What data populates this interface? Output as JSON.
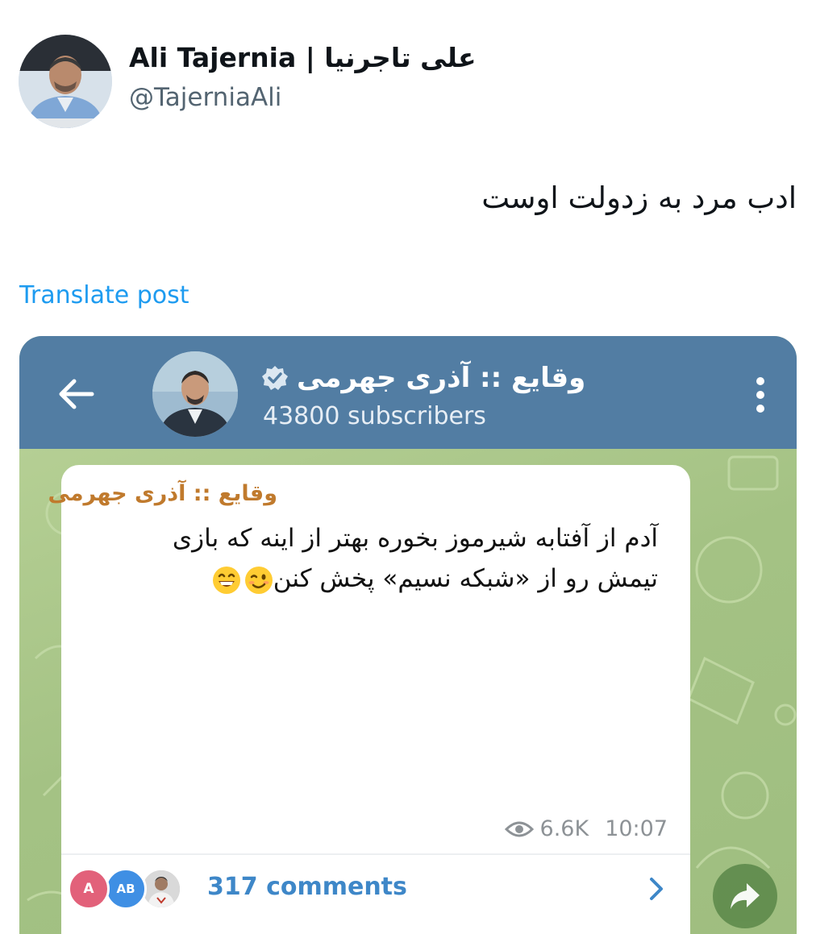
{
  "post": {
    "author_name": "Ali Tajernia | علی تاجرنیا",
    "author_handle": "@TajerniaAli",
    "text": "ادب مرد به زدولت اوست",
    "translate_label": "Translate post"
  },
  "telegram": {
    "channel_title": "وقایع :: آذری جهرمی",
    "subscribers": "43800 subscribers",
    "message": {
      "author": "وقایع :: آذری جهرمی",
      "line1": "آدم از آفتابه شیرموز بخوره بهتر از اینه که بازی",
      "line2": "تیمش رو از «شبکه نسیم» پخش کنن",
      "views": "6.6K",
      "time": "10:07"
    },
    "comments": {
      "avatar_a": "A",
      "avatar_ab": "AB",
      "label": "317 comments"
    },
    "colors": {
      "header": "#527da3",
      "chat_bg": "#a8c48a",
      "author_accent": "#c07a2d",
      "link": "#1d9bf0",
      "comments": "#3e87c8"
    },
    "icons": {
      "back": "arrow-left-icon",
      "menu": "more-vertical-icon",
      "verified": "verified-badge-icon",
      "views": "eye-icon",
      "chevron": "chevron-right-icon",
      "share": "share-arrow-icon",
      "emoji_wink": "winking-face-icon",
      "emoji_grin": "grinning-face-icon"
    }
  }
}
